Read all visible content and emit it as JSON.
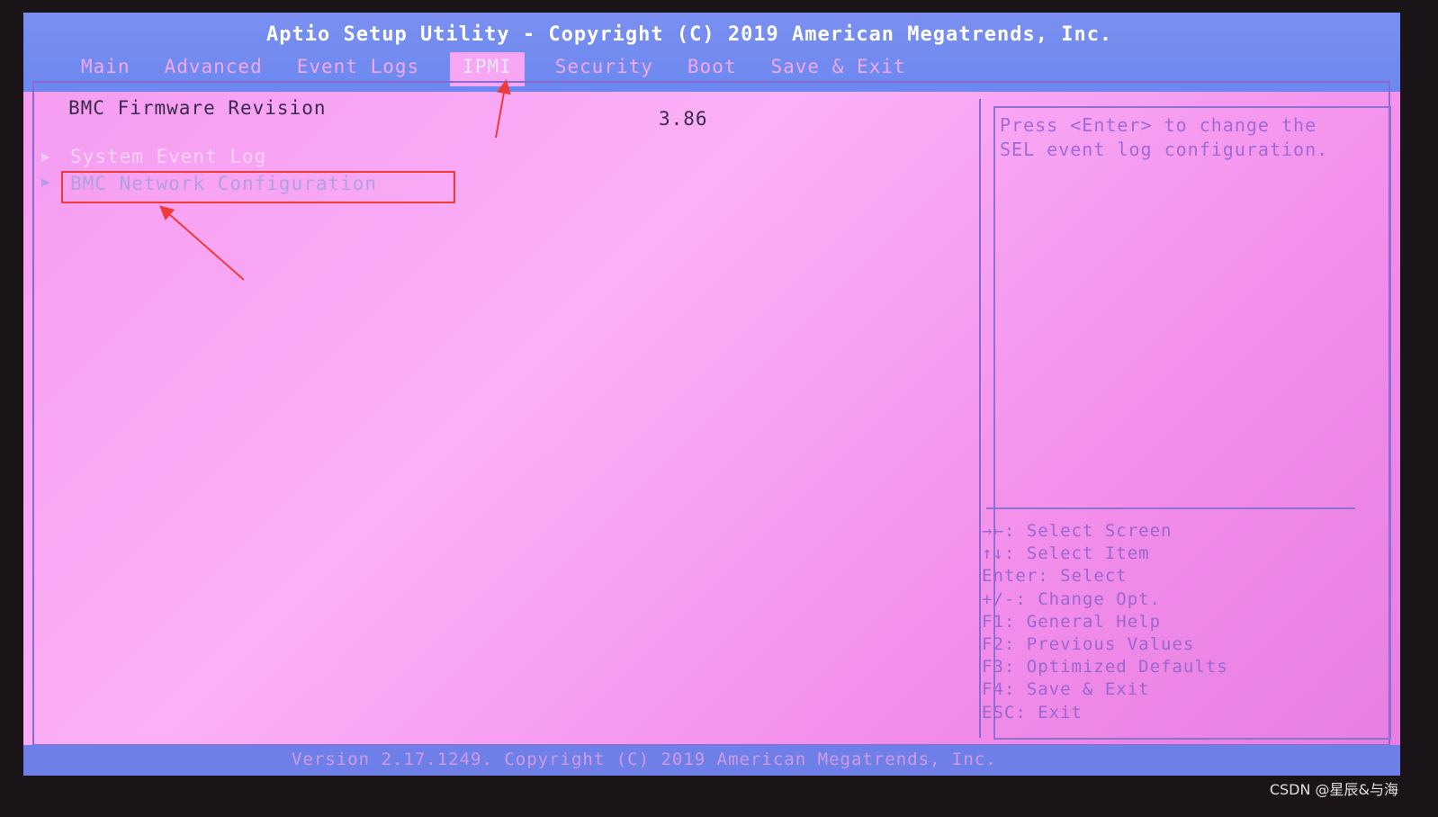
{
  "header": {
    "title": "Aptio Setup Utility - Copyright (C) 2019 American Megatrends, Inc."
  },
  "tabs": [
    {
      "label": "Main"
    },
    {
      "label": "Advanced"
    },
    {
      "label": "Event Logs"
    },
    {
      "label": "IPMI",
      "active": true
    },
    {
      "label": "Security"
    },
    {
      "label": "Boot"
    },
    {
      "label": "Save & Exit"
    }
  ],
  "main": {
    "firmware_label": "BMC Firmware Revision",
    "firmware_value": "3.86",
    "items": [
      {
        "label": "System Event Log"
      },
      {
        "label": "BMC Network Configuration"
      }
    ]
  },
  "help": {
    "line1": "Press <Enter> to change the",
    "line2": "SEL event log configuration."
  },
  "keys": [
    "→←: Select Screen",
    "↑↓: Select Item",
    "Enter: Select",
    "+/-: Change Opt.",
    "F1: General Help",
    "F2: Previous Values",
    "F3: Optimized Defaults",
    "F4: Save & Exit",
    "ESC: Exit"
  ],
  "footer": {
    "text": "Version 2.17.1249. Copyright (C) 2019 American Megatrends, Inc."
  },
  "watermark": "CSDN @星辰&与海",
  "colors": {
    "header": "#6c88f0",
    "body": "#f59af0",
    "annotation": "#f03a3a"
  }
}
